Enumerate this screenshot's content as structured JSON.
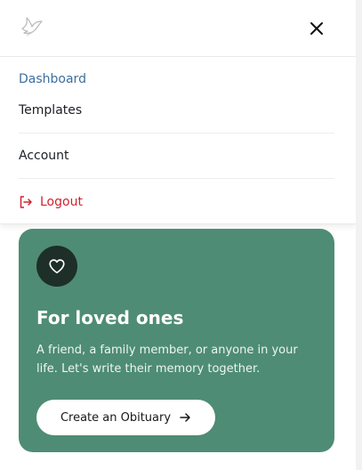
{
  "header": {
    "logo_icon": "dove-icon",
    "close_icon": "close-icon"
  },
  "menu": {
    "items": [
      {
        "label": "Dashboard",
        "color": "#3d6f9e"
      },
      {
        "label": "Templates"
      },
      {
        "label": "Account"
      }
    ],
    "logout": {
      "label": "Logout",
      "icon": "logout-icon",
      "color": "#d1232f"
    }
  },
  "card": {
    "icon": "heart-icon",
    "title": "For loved ones",
    "description": "A friend, a family member, or anyone in your life. Let's write their memory together.",
    "cta_label": "Create an Obituary",
    "cta_icon": "arrow-right-icon",
    "background": "#4e8c75"
  }
}
